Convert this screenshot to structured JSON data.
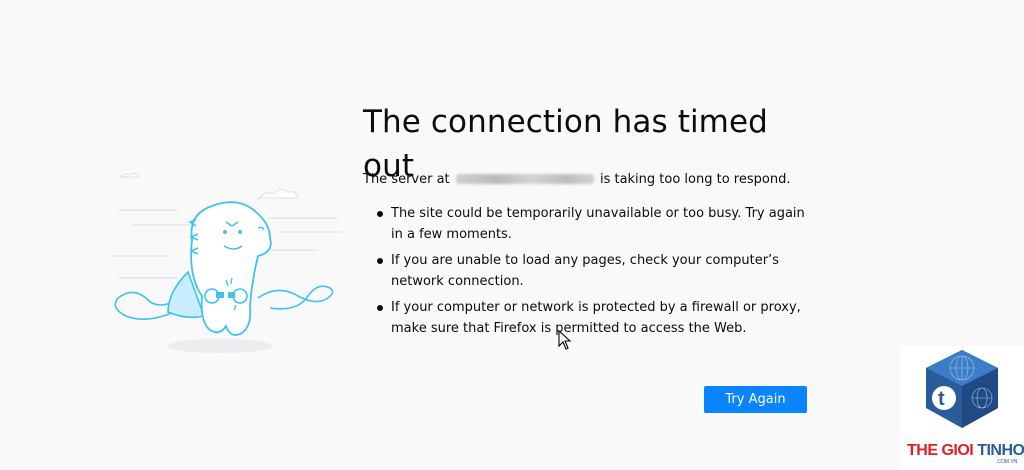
{
  "error": {
    "title": "The connection has timed out",
    "intro_before": "The server at",
    "intro_after": "is taking too long to respond.",
    "bullets": [
      "The site could be temporarily unavailable or too busy. Try again in a few moments.",
      "If you are unable to load any pages, check your computer’s network connection.",
      "If your computer or network is protected by a firewall or proxy, make sure that Firefox is permitted to access the Web."
    ],
    "button_label": "Try Again"
  },
  "watermark": {
    "word1": "THE GIOI",
    "word2": "TINHOC",
    "domain": ".COM.VN"
  },
  "colors": {
    "background": "#f9f9fa",
    "accent": "#0a84ff",
    "text": "#0c0c0d",
    "illustration_line": "#3fc1f2",
    "watermark_red": "#e02025",
    "watermark_blue": "#2a5b9b"
  },
  "icons": {
    "illustration": "unplugged-dinosaur-illustration",
    "cursor": "mouse-pointer-icon",
    "logo": "thegioitinhoc-logo-icon"
  }
}
